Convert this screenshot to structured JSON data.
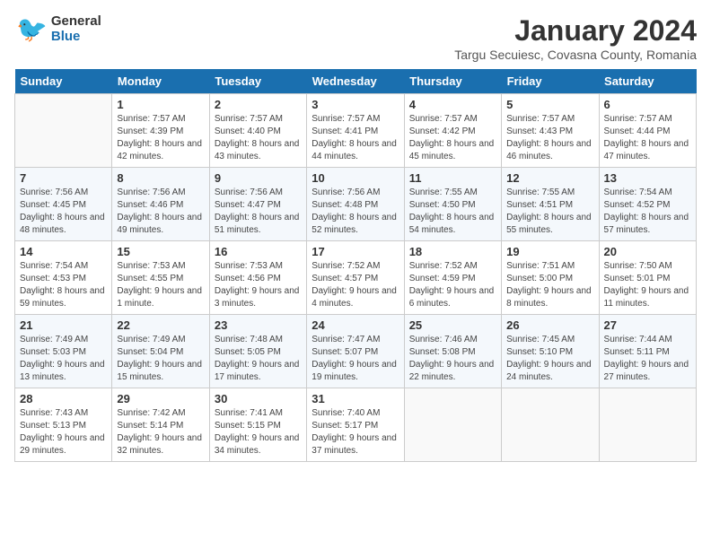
{
  "header": {
    "logo_general": "General",
    "logo_blue": "Blue",
    "month_title": "January 2024",
    "location": "Targu Secuiesc, Covasna County, Romania"
  },
  "days_of_week": [
    "Sunday",
    "Monday",
    "Tuesday",
    "Wednesday",
    "Thursday",
    "Friday",
    "Saturday"
  ],
  "weeks": [
    [
      {
        "day": "",
        "sunrise": "",
        "sunset": "",
        "daylight": ""
      },
      {
        "day": "1",
        "sunrise": "Sunrise: 7:57 AM",
        "sunset": "Sunset: 4:39 PM",
        "daylight": "Daylight: 8 hours and 42 minutes."
      },
      {
        "day": "2",
        "sunrise": "Sunrise: 7:57 AM",
        "sunset": "Sunset: 4:40 PM",
        "daylight": "Daylight: 8 hours and 43 minutes."
      },
      {
        "day": "3",
        "sunrise": "Sunrise: 7:57 AM",
        "sunset": "Sunset: 4:41 PM",
        "daylight": "Daylight: 8 hours and 44 minutes."
      },
      {
        "day": "4",
        "sunrise": "Sunrise: 7:57 AM",
        "sunset": "Sunset: 4:42 PM",
        "daylight": "Daylight: 8 hours and 45 minutes."
      },
      {
        "day": "5",
        "sunrise": "Sunrise: 7:57 AM",
        "sunset": "Sunset: 4:43 PM",
        "daylight": "Daylight: 8 hours and 46 minutes."
      },
      {
        "day": "6",
        "sunrise": "Sunrise: 7:57 AM",
        "sunset": "Sunset: 4:44 PM",
        "daylight": "Daylight: 8 hours and 47 minutes."
      }
    ],
    [
      {
        "day": "7",
        "sunrise": "Sunrise: 7:56 AM",
        "sunset": "Sunset: 4:45 PM",
        "daylight": "Daylight: 8 hours and 48 minutes."
      },
      {
        "day": "8",
        "sunrise": "Sunrise: 7:56 AM",
        "sunset": "Sunset: 4:46 PM",
        "daylight": "Daylight: 8 hours and 49 minutes."
      },
      {
        "day": "9",
        "sunrise": "Sunrise: 7:56 AM",
        "sunset": "Sunset: 4:47 PM",
        "daylight": "Daylight: 8 hours and 51 minutes."
      },
      {
        "day": "10",
        "sunrise": "Sunrise: 7:56 AM",
        "sunset": "Sunset: 4:48 PM",
        "daylight": "Daylight: 8 hours and 52 minutes."
      },
      {
        "day": "11",
        "sunrise": "Sunrise: 7:55 AM",
        "sunset": "Sunset: 4:50 PM",
        "daylight": "Daylight: 8 hours and 54 minutes."
      },
      {
        "day": "12",
        "sunrise": "Sunrise: 7:55 AM",
        "sunset": "Sunset: 4:51 PM",
        "daylight": "Daylight: 8 hours and 55 minutes."
      },
      {
        "day": "13",
        "sunrise": "Sunrise: 7:54 AM",
        "sunset": "Sunset: 4:52 PM",
        "daylight": "Daylight: 8 hours and 57 minutes."
      }
    ],
    [
      {
        "day": "14",
        "sunrise": "Sunrise: 7:54 AM",
        "sunset": "Sunset: 4:53 PM",
        "daylight": "Daylight: 8 hours and 59 minutes."
      },
      {
        "day": "15",
        "sunrise": "Sunrise: 7:53 AM",
        "sunset": "Sunset: 4:55 PM",
        "daylight": "Daylight: 9 hours and 1 minute."
      },
      {
        "day": "16",
        "sunrise": "Sunrise: 7:53 AM",
        "sunset": "Sunset: 4:56 PM",
        "daylight": "Daylight: 9 hours and 3 minutes."
      },
      {
        "day": "17",
        "sunrise": "Sunrise: 7:52 AM",
        "sunset": "Sunset: 4:57 PM",
        "daylight": "Daylight: 9 hours and 4 minutes."
      },
      {
        "day": "18",
        "sunrise": "Sunrise: 7:52 AM",
        "sunset": "Sunset: 4:59 PM",
        "daylight": "Daylight: 9 hours and 6 minutes."
      },
      {
        "day": "19",
        "sunrise": "Sunrise: 7:51 AM",
        "sunset": "Sunset: 5:00 PM",
        "daylight": "Daylight: 9 hours and 8 minutes."
      },
      {
        "day": "20",
        "sunrise": "Sunrise: 7:50 AM",
        "sunset": "Sunset: 5:01 PM",
        "daylight": "Daylight: 9 hours and 11 minutes."
      }
    ],
    [
      {
        "day": "21",
        "sunrise": "Sunrise: 7:49 AM",
        "sunset": "Sunset: 5:03 PM",
        "daylight": "Daylight: 9 hours and 13 minutes."
      },
      {
        "day": "22",
        "sunrise": "Sunrise: 7:49 AM",
        "sunset": "Sunset: 5:04 PM",
        "daylight": "Daylight: 9 hours and 15 minutes."
      },
      {
        "day": "23",
        "sunrise": "Sunrise: 7:48 AM",
        "sunset": "Sunset: 5:05 PM",
        "daylight": "Daylight: 9 hours and 17 minutes."
      },
      {
        "day": "24",
        "sunrise": "Sunrise: 7:47 AM",
        "sunset": "Sunset: 5:07 PM",
        "daylight": "Daylight: 9 hours and 19 minutes."
      },
      {
        "day": "25",
        "sunrise": "Sunrise: 7:46 AM",
        "sunset": "Sunset: 5:08 PM",
        "daylight": "Daylight: 9 hours and 22 minutes."
      },
      {
        "day": "26",
        "sunrise": "Sunrise: 7:45 AM",
        "sunset": "Sunset: 5:10 PM",
        "daylight": "Daylight: 9 hours and 24 minutes."
      },
      {
        "day": "27",
        "sunrise": "Sunrise: 7:44 AM",
        "sunset": "Sunset: 5:11 PM",
        "daylight": "Daylight: 9 hours and 27 minutes."
      }
    ],
    [
      {
        "day": "28",
        "sunrise": "Sunrise: 7:43 AM",
        "sunset": "Sunset: 5:13 PM",
        "daylight": "Daylight: 9 hours and 29 minutes."
      },
      {
        "day": "29",
        "sunrise": "Sunrise: 7:42 AM",
        "sunset": "Sunset: 5:14 PM",
        "daylight": "Daylight: 9 hours and 32 minutes."
      },
      {
        "day": "30",
        "sunrise": "Sunrise: 7:41 AM",
        "sunset": "Sunset: 5:15 PM",
        "daylight": "Daylight: 9 hours and 34 minutes."
      },
      {
        "day": "31",
        "sunrise": "Sunrise: 7:40 AM",
        "sunset": "Sunset: 5:17 PM",
        "daylight": "Daylight: 9 hours and 37 minutes."
      },
      {
        "day": "",
        "sunrise": "",
        "sunset": "",
        "daylight": ""
      },
      {
        "day": "",
        "sunrise": "",
        "sunset": "",
        "daylight": ""
      },
      {
        "day": "",
        "sunrise": "",
        "sunset": "",
        "daylight": ""
      }
    ]
  ]
}
